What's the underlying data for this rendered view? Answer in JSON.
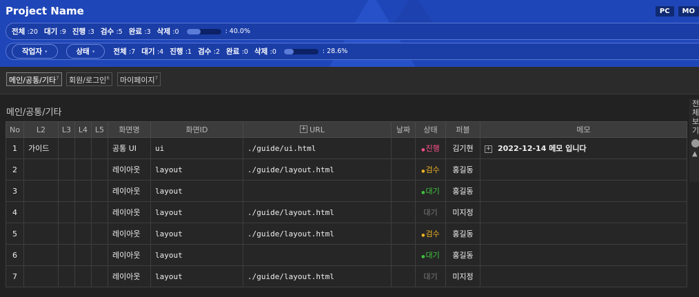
{
  "header": {
    "title": "Project Name",
    "device_pc": "PC",
    "device_mo": "MO",
    "summary": {
      "items": [
        {
          "label": "전체",
          "value": ":20"
        },
        {
          "label": "대기",
          "value": ":9"
        },
        {
          "label": "진행",
          "value": ":3"
        },
        {
          "label": "검수",
          "value": ":5"
        },
        {
          "label": "완료",
          "value": ":3"
        },
        {
          "label": "삭제",
          "value": ":0"
        }
      ],
      "progress": 0.4,
      "progress_text": ": 40.0%"
    },
    "filter": {
      "worker_label": "작업자",
      "status_label": "상태",
      "items": [
        {
          "label": "전체",
          "value": ":7"
        },
        {
          "label": "대기",
          "value": ":4"
        },
        {
          "label": "진행",
          "value": ":1"
        },
        {
          "label": "검수",
          "value": ":2"
        },
        {
          "label": "완료",
          "value": ":0"
        },
        {
          "label": "삭제",
          "value": ":0"
        }
      ],
      "progress": 0.286,
      "progress_text": ": 28.6%"
    }
  },
  "tabs": [
    {
      "label": "메인/공통/기타",
      "count": "7"
    },
    {
      "label": "회원/로그인",
      "count": "6"
    },
    {
      "label": "마이페이지",
      "count": "7"
    }
  ],
  "section_title": "메인/공통/기타",
  "table": {
    "headers": [
      "No",
      "L2",
      "L3",
      "L4",
      "L5",
      "화면명",
      "화면ID",
      "URL",
      "날짜",
      "상태",
      "퍼블",
      "메모"
    ],
    "rows": [
      {
        "no": "1",
        "l2": "가이드",
        "name": "공통 UI",
        "id": "ui",
        "url": "./guide/ui.html",
        "status": "진행",
        "worker": "김기현",
        "memo": "2022-12-14 메모 입니다"
      },
      {
        "no": "2",
        "l2": "",
        "name": "레이아웃",
        "id": "layout",
        "url": "./guide/layout.html",
        "status": "검수",
        "worker": "홍길동",
        "memo": ""
      },
      {
        "no": "3",
        "l2": "",
        "name": "레이아웃",
        "id": "layout",
        "url": "",
        "status": "대기",
        "worker": "홍길동",
        "memo": ""
      },
      {
        "no": "4",
        "l2": "",
        "name": "레이아웃",
        "id": "layout",
        "url": "./guide/layout.html",
        "status": "대기",
        "worker": "미지정",
        "memo": ""
      },
      {
        "no": "5",
        "l2": "",
        "name": "레이아웃",
        "id": "layout",
        "url": "./guide/layout.html",
        "status": "검수",
        "worker": "홍길동",
        "memo": ""
      },
      {
        "no": "6",
        "l2": "",
        "name": "레이아웃",
        "id": "layout",
        "url": "",
        "status": "대기",
        "worker": "홍길동",
        "memo": ""
      },
      {
        "no": "7",
        "l2": "",
        "name": "레이아웃",
        "id": "layout",
        "url": "./guide/layout.html",
        "status": "대기",
        "worker": "미지정",
        "memo": ""
      }
    ]
  },
  "side_panel": {
    "text": "전체보기"
  },
  "colors": {
    "header_bg": "#1f46b8",
    "status_progress": "#ff4f8b",
    "status_review": "#f0b323",
    "status_wait": "#3fc43f"
  }
}
